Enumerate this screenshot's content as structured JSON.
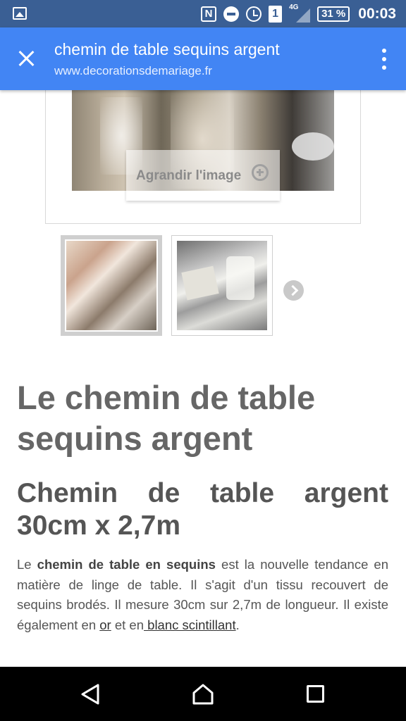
{
  "status_bar": {
    "nfc_label": "N",
    "sim_label": "1",
    "network_label": "4G",
    "battery_label": "31 %",
    "time": "00:03"
  },
  "app_bar": {
    "title": "chemin de table sequins argent",
    "url": "www.decorationsdemariage.fr"
  },
  "gallery": {
    "enlarge_label": "Agrandir l'image",
    "thumbnails": [
      {
        "label": "thumbnail-1",
        "selected": true
      },
      {
        "label": "thumbnail-2",
        "selected": false
      }
    ]
  },
  "article": {
    "title": "Le chemin de table sequins argent",
    "subtitle": "Chemin de table argent 30cm x 2,7m",
    "body": {
      "t1": "Le ",
      "b1": "chemin de table en sequins",
      "t2": " est la nouvelle tendance en matière de linge de table. Il s'agit d'un tissu recouvert de sequins brodés. Il mesure 30cm sur 2,7m de longueur. Il existe également en ",
      "link1": "or",
      "t3": " et en",
      "link2": " blanc scintillant",
      "t4": "."
    }
  },
  "colors": {
    "status_bar": "#3a5f94",
    "app_bar": "#4285f4",
    "nav_bar": "#000000"
  }
}
